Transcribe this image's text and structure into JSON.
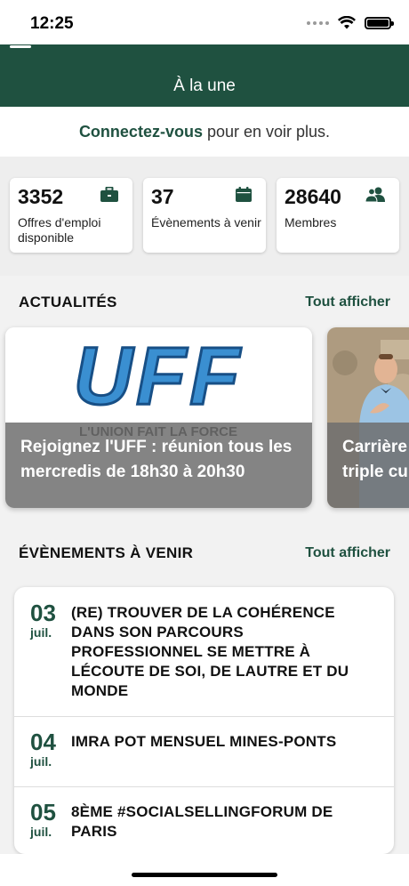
{
  "status_bar": {
    "time": "12:25"
  },
  "nav": {
    "title": "À la une"
  },
  "login_prompt": {
    "link": "Connectez-vous",
    "rest": "pour en voir plus."
  },
  "stats": [
    {
      "value": "3352",
      "label": "Offres d'emploi disponible",
      "icon": "briefcase-icon"
    },
    {
      "value": "37",
      "label": "Évènements à venir",
      "icon": "calendar-icon"
    },
    {
      "value": "28640",
      "label": "Membres",
      "icon": "members-icon"
    }
  ],
  "news": {
    "heading": "ACTUALITÉS",
    "see_all": "Tout afficher",
    "items": [
      {
        "title": "Rejoignez l'UFF : réunion tous les mercredis de 18h30 à 20h30",
        "logo_text": "UFF",
        "logo_sub": "L'UNION FAIT LA FORCE"
      },
      {
        "title": "Carrière triple cu"
      }
    ]
  },
  "events": {
    "heading": "ÉVÈNEMENTS À VENIR",
    "see_all": "Tout afficher",
    "items": [
      {
        "day": "03",
        "month": "juil.",
        "title": "(RE) TROUVER DE LA COHÉRENCE DANS SON PARCOURS PROFESSIONNEL SE METTRE À LÉCOUTE DE SOI, DE LAUTRE ET DU MONDE"
      },
      {
        "day": "04",
        "month": "juil.",
        "title": "IMRA POT MENSUEL MINES-PONTS"
      },
      {
        "day": "05",
        "month": "juil.",
        "title": "8ÈME #SOCIALSELLINGFORUM DE PARIS"
      }
    ]
  },
  "colors": {
    "brand": "#1f5140",
    "overlay": "#6e6e6e",
    "background": "#f2f2f2"
  }
}
